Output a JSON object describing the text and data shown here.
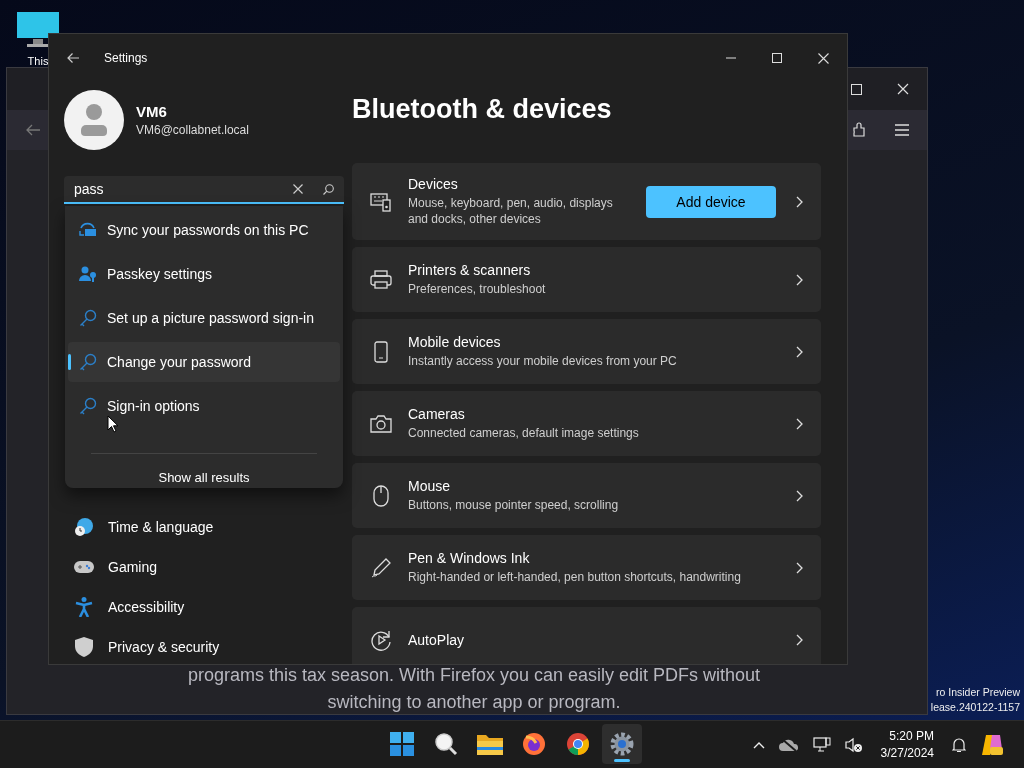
{
  "desktop": {
    "icons": [
      {
        "label": "This"
      }
    ],
    "watermark": [
      "ro Insider Preview",
      "lease.240122-1157"
    ]
  },
  "browser_window": {
    "page_text": [
      "programs this tax season. With Firefox you can easily edit PDFs without",
      "switching to another app or program."
    ]
  },
  "settings": {
    "title": "Settings",
    "user": {
      "name": "VM6",
      "email": "VM6@collabnet.local"
    },
    "search": {
      "value": "pass"
    },
    "search_results": [
      {
        "label": "Sync your passwords on this PC",
        "kind": "sync",
        "hovered": false
      },
      {
        "label": "Passkey settings",
        "kind": "passkey",
        "hovered": false
      },
      {
        "label": "Set up a picture password sign-in",
        "kind": "key",
        "hovered": false
      },
      {
        "label": "Change your password",
        "kind": "key",
        "hovered": true
      },
      {
        "label": "Sign-in options",
        "kind": "key",
        "hovered": false
      }
    ],
    "show_all": "Show all results",
    "nav": [
      {
        "label": "Time & language",
        "kind": "time"
      },
      {
        "label": "Gaming",
        "kind": "gaming"
      },
      {
        "label": "Accessibility",
        "kind": "accessibility"
      },
      {
        "label": "Privacy & security",
        "kind": "shield"
      }
    ],
    "page_title": "Bluetooth & devices",
    "cards": [
      {
        "kind": "devices",
        "title": "Devices",
        "subtitle": "Mouse, keyboard, pen, audio, displays and docks, other devices",
        "button": "Add device"
      },
      {
        "kind": "printer",
        "title": "Printers & scanners",
        "subtitle": "Preferences, troubleshoot"
      },
      {
        "kind": "phone",
        "title": "Mobile devices",
        "subtitle": "Instantly access your mobile devices from your PC"
      },
      {
        "kind": "camera",
        "title": "Cameras",
        "subtitle": "Connected cameras, default image settings"
      },
      {
        "kind": "mouse",
        "title": "Mouse",
        "subtitle": "Buttons, mouse pointer speed, scrolling"
      },
      {
        "kind": "pen",
        "title": "Pen & Windows Ink",
        "subtitle": "Right-handed or left-handed, pen button shortcuts, handwriting"
      },
      {
        "kind": "autoplay",
        "title": "AutoPlay"
      }
    ]
  },
  "taskbar": {
    "apps": [
      {
        "kind": "start",
        "active": false
      },
      {
        "kind": "search",
        "active": false
      },
      {
        "kind": "folder",
        "active": false
      },
      {
        "kind": "firefox",
        "active": false
      },
      {
        "kind": "chrome",
        "active": false
      },
      {
        "kind": "settings",
        "active": true
      }
    ],
    "time": "5:20 PM",
    "date": "3/27/2024"
  }
}
